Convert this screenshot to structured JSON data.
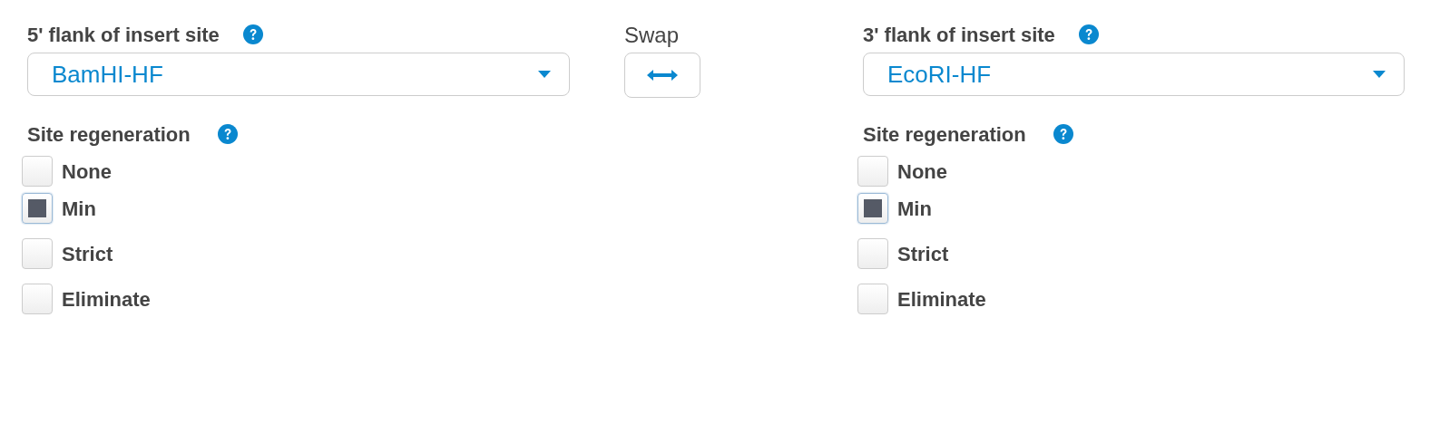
{
  "flanks": [
    {
      "label": "5' flank of insert site",
      "value": "BamHI-HF",
      "regeneration_label": "Site regeneration",
      "options": [
        {
          "label": "None",
          "checked": false
        },
        {
          "label": "Min",
          "checked": true
        },
        {
          "label": "Strict",
          "checked": false
        },
        {
          "label": "Eliminate",
          "checked": false
        }
      ]
    },
    {
      "label": "3' flank of insert site",
      "value": "EcoRI-HF",
      "regeneration_label": "Site regeneration",
      "options": [
        {
          "label": "None",
          "checked": false
        },
        {
          "label": "Min",
          "checked": true
        },
        {
          "label": "Strict",
          "checked": false
        },
        {
          "label": "Eliminate",
          "checked": false
        }
      ]
    }
  ],
  "swap": {
    "label": "Swap"
  }
}
